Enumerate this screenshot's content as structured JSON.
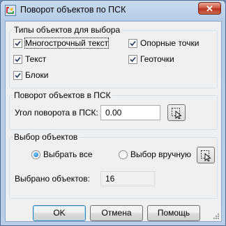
{
  "window": {
    "title": "Поворот объектов по ПСК",
    "close_label": "✕"
  },
  "object_types": {
    "legend": "Типы объектов для выбора",
    "items": [
      {
        "label": "Многострочный текст",
        "checked": true
      },
      {
        "label": "Текст",
        "checked": true
      },
      {
        "label": "Блоки",
        "checked": true
      },
      {
        "label": "Опорные точки",
        "checked": true
      },
      {
        "label": "Геоточки",
        "checked": true
      }
    ]
  },
  "rotation": {
    "legend": "Поворот объектов в ПСК",
    "angle_label": "Угол поворота в ПСК:",
    "angle_value": "0.00"
  },
  "selection": {
    "legend": "Выбор объектов",
    "select_all_label": "Выбрать все",
    "manual_label": "Выбор вручную",
    "selected_mode": "select_all",
    "count_label": "Выбрано объектов:",
    "count_value": "16"
  },
  "buttons": {
    "ok": "OK",
    "cancel": "Отмена",
    "help": "Помощь"
  },
  "colors": {
    "accent": "#3c7fb1",
    "close": "#c7432b"
  }
}
